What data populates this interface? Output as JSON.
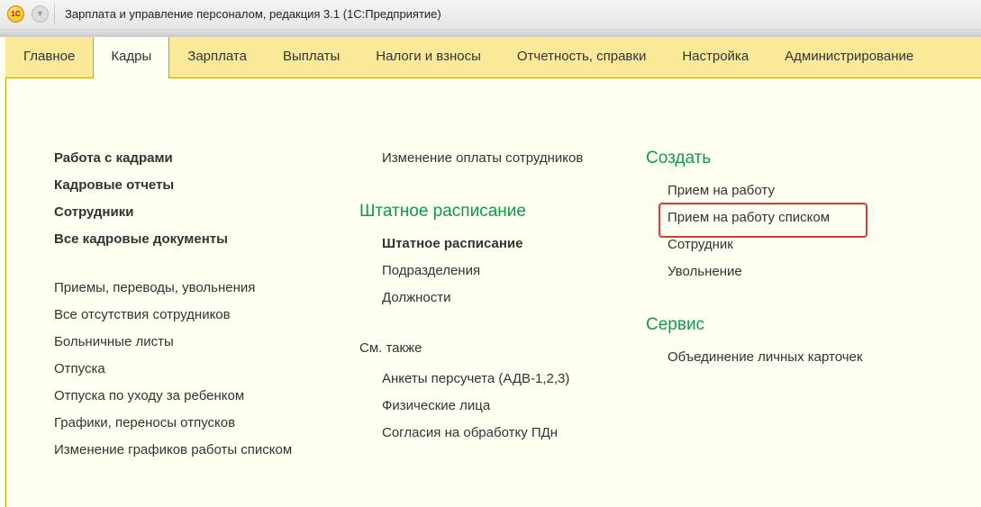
{
  "window": {
    "title": "Зарплата и управление персоналом, редакция 3.1  (1С:Предприятие)",
    "logo": "1С"
  },
  "tabs": [
    "Главное",
    "Кадры",
    "Зарплата",
    "Выплаты",
    "Налоги и взносы",
    "Отчетность, справки",
    "Настройка",
    "Администрирование"
  ],
  "active_tab": "Кадры",
  "col1": {
    "main": [
      "Работа с кадрами",
      "Кадровые отчеты",
      "Сотрудники",
      "Все кадровые документы"
    ],
    "items": [
      "Приемы, переводы, увольнения",
      "Все отсутствия сотрудников",
      "Больничные листы",
      "Отпуска",
      "Отпуска по уходу за ребенком",
      "Графики, переносы отпусков",
      "Изменение графиков работы списком"
    ]
  },
  "col2": {
    "top": "Изменение оплаты сотрудников",
    "heading": "Штатное расписание",
    "items": [
      "Штатное расписание",
      "Подразделения",
      "Должности"
    ],
    "see_also": "См. также",
    "see_items": [
      "Анкеты персучета (АДВ-1,2,3)",
      "Физические лица",
      "Согласия на обработку ПДн"
    ]
  },
  "col3": {
    "create_heading": "Создать",
    "create_items": [
      "Прием на работу",
      "Прием на работу списком",
      "Сотрудник",
      "Увольнение"
    ],
    "service_heading": "Сервис",
    "service_items": [
      "Объединение личных карточек"
    ]
  },
  "colors": {
    "heading": "#0e9c4a",
    "tabbar": "#fbe99a",
    "highlight": "#e03a2e"
  }
}
